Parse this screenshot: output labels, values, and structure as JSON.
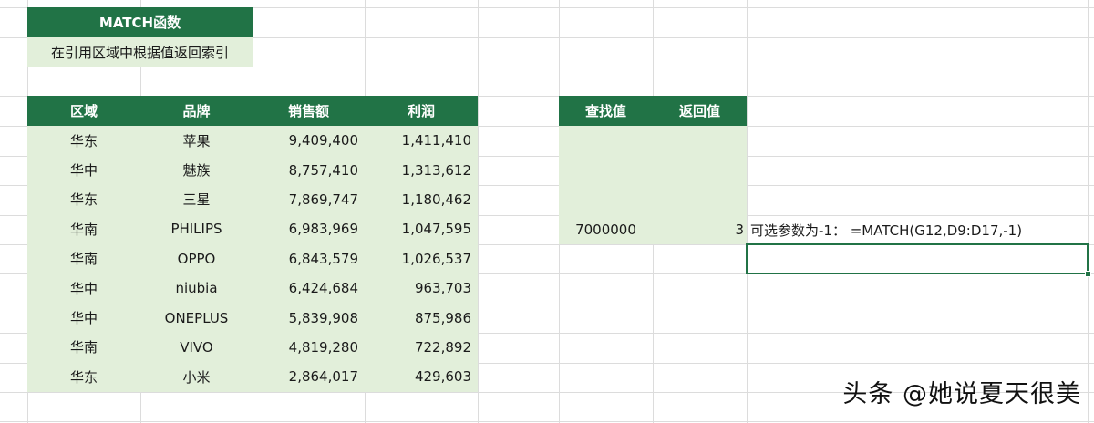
{
  "title_block": {
    "title": "MATCH函数",
    "subtitle": "在引用区域中根据值返回索引"
  },
  "table": {
    "headers": [
      "区域",
      "品牌",
      "销售额",
      "利润"
    ],
    "rows": [
      [
        "华东",
        "苹果",
        "9,409,400",
        "1,411,410"
      ],
      [
        "华中",
        "魅族",
        "8,757,410",
        "1,313,612"
      ],
      [
        "华东",
        "三星",
        "7,869,747",
        "1,180,462"
      ],
      [
        "华南",
        "PHILIPS",
        "6,983,969",
        "1,047,595"
      ],
      [
        "华南",
        "OPPO",
        "6,843,579",
        "1,026,537"
      ],
      [
        "华中",
        "niubia",
        "6,424,684",
        "963,703"
      ],
      [
        "华中",
        "ONEPLUS",
        "5,839,908",
        "875,986"
      ],
      [
        "华南",
        "VIVO",
        "4,819,280",
        "722,892"
      ],
      [
        "华东",
        "小米",
        "2,864,017",
        "429,603"
      ]
    ]
  },
  "lookup": {
    "header_lookup": "查找值",
    "header_return": "返回值",
    "lookup_value": "7000000",
    "return_value": "3",
    "note": "可选参数为-1：  =MATCH(G12,D9:D17,-1)"
  },
  "watermark": "头条 @她说夏天很美",
  "colors": {
    "header_green": "#217346",
    "light_green": "#e2efda",
    "gridline": "#dcdcdc"
  }
}
